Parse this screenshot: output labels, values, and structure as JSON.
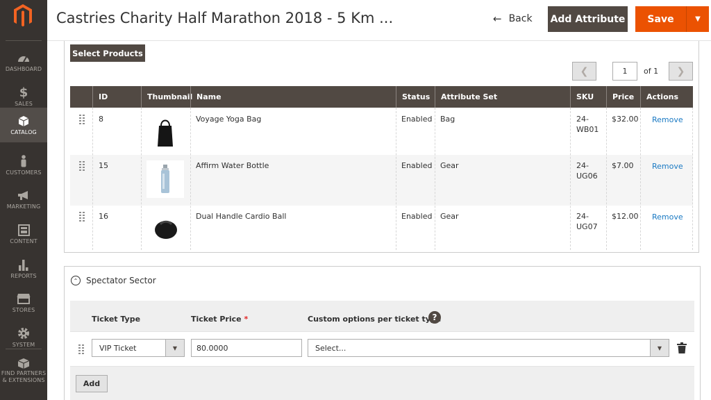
{
  "header": {
    "title": "Castries Charity Half Marathon 2018 - 5 Km ...",
    "back_label": "Back",
    "add_attribute_label": "Add Attribute",
    "save_label": "Save"
  },
  "sidebar": {
    "items": [
      {
        "label": "DASHBOARD",
        "icon": "dashboard-icon"
      },
      {
        "label": "SALES",
        "icon": "dollar-icon"
      },
      {
        "label": "CATALOG",
        "icon": "cube-icon",
        "active": true
      },
      {
        "label": "CUSTOMERS",
        "icon": "person-icon"
      },
      {
        "label": "MARKETING",
        "icon": "megaphone-icon"
      },
      {
        "label": "CONTENT",
        "icon": "layout-icon"
      },
      {
        "label": "REPORTS",
        "icon": "bar-chart-icon"
      },
      {
        "label": "STORES",
        "icon": "store-icon"
      },
      {
        "label": "SYSTEM",
        "icon": "gear-icon"
      },
      {
        "label": "FIND PARTNERS",
        "label2": "& EXTENSIONS",
        "icon": "box-icon"
      }
    ]
  },
  "products": {
    "select_label": "Select Products",
    "pager": {
      "page": "1",
      "of_label": "of 1"
    },
    "columns": [
      "ID",
      "Thumbnail",
      "Name",
      "Status",
      "Attribute Set",
      "SKU",
      "Price",
      "Actions"
    ],
    "rows": [
      {
        "id": "8",
        "name": "Voyage Yoga Bag",
        "status": "Enabled",
        "attribute_set": "Bag",
        "sku1": "24-",
        "sku2": "WB01",
        "price": "$32.00",
        "action": "Remove"
      },
      {
        "id": "15",
        "name": "Affirm Water Bottle",
        "status": "Enabled",
        "attribute_set": "Gear",
        "sku1": "24-",
        "sku2": "UG06",
        "price": "$7.00",
        "action": "Remove"
      },
      {
        "id": "16",
        "name": "Dual Handle Cardio Ball",
        "status": "Enabled",
        "attribute_set": "Gear",
        "sku1": "24-",
        "sku2": "UG07",
        "price": "$12.00",
        "action": "Remove"
      }
    ]
  },
  "spectator": {
    "title": "Spectator Sector",
    "ticket_type_label": "Ticket Type",
    "ticket_price_label": "Ticket Price",
    "required_mark": "*",
    "custom_options_label": "Custom options per ticket type",
    "help_mark": "?",
    "ticket_type_value": "VIP Ticket",
    "ticket_price_value": "80.0000",
    "custom_options_value": "Select...",
    "add_label": "Add"
  },
  "colors": {
    "sidebar_bg": "#373330",
    "accent": "#eb5202",
    "dark_button": "#514943",
    "link": "#1979c3"
  }
}
